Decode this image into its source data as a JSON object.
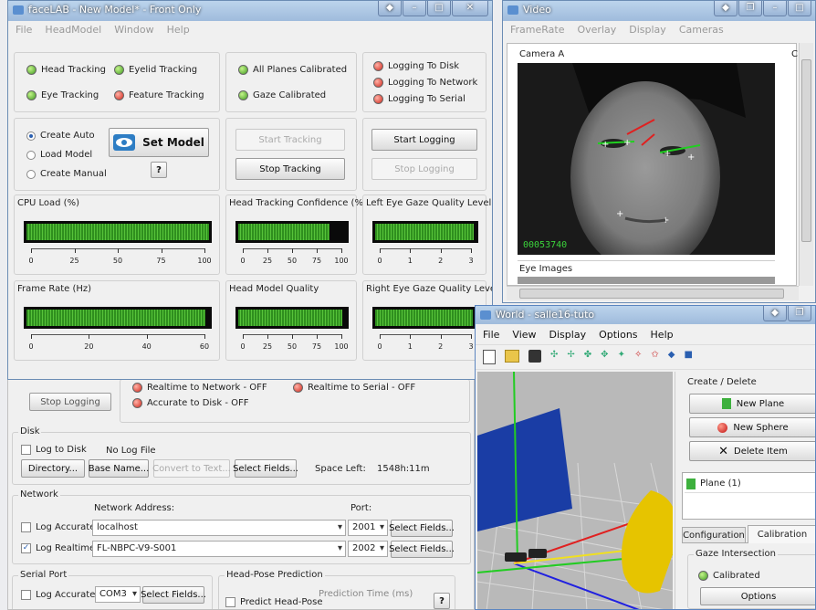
{
  "facelab": {
    "title": "faceLAB - New Model* - Front Only",
    "menu": [
      "File",
      "HeadModel",
      "Window",
      "Help"
    ],
    "status_left": [
      {
        "label": "Head Tracking",
        "color": "green"
      },
      {
        "label": "Eyelid Tracking",
        "color": "green"
      },
      {
        "label": "Eye Tracking",
        "color": "green"
      },
      {
        "label": "Feature Tracking",
        "color": "red"
      }
    ],
    "status_mid": [
      {
        "label": "All Planes Calibrated",
        "color": "green"
      },
      {
        "label": "Gaze Calibrated",
        "color": "green"
      }
    ],
    "status_right": [
      {
        "label": "Logging To Disk",
        "color": "red"
      },
      {
        "label": "Logging To Network",
        "color": "red"
      },
      {
        "label": "Logging To Serial",
        "color": "red"
      }
    ],
    "model_options": [
      {
        "label": "Create Auto",
        "selected": true
      },
      {
        "label": "Load Model",
        "selected": false
      },
      {
        "label": "Create Manual",
        "selected": false
      }
    ],
    "set_model": "Set Model",
    "help_glyph": "?",
    "start_tracking": "Start Tracking",
    "stop_tracking": "Stop Tracking",
    "start_logging": "Start Logging",
    "stop_logging": "Stop Logging",
    "meters": [
      {
        "title": "CPU Load (%)",
        "value": 1.0,
        "ticks": [
          "0",
          "25",
          "50",
          "75",
          "100"
        ]
      },
      {
        "title": "Head Tracking Confidence (%)",
        "value": 0.85,
        "ticks": [
          "0",
          "25",
          "50",
          "75",
          "100"
        ]
      },
      {
        "title": "Left Eye Gaze Quality Level",
        "value": 0.98,
        "ticks": [
          "0",
          "1",
          "2",
          "3"
        ]
      },
      {
        "title": "Frame Rate (Hz)",
        "value": 0.98,
        "ticks": [
          "0",
          "20",
          "40",
          "60"
        ]
      },
      {
        "title": "Head Model Quality",
        "value": 0.97,
        "ticks": [
          "0",
          "25",
          "50",
          "75",
          "100"
        ]
      },
      {
        "title": "Right Eye Gaze Quality Level",
        "value": 0.97,
        "ticks": [
          "0",
          "1",
          "2",
          "3"
        ]
      }
    ]
  },
  "logwin": {
    "stop_logging": "Stop Logging",
    "realtime_network": "Realtime to Network - OFF",
    "realtime_serial": "Realtime to Serial - OFF",
    "accurate_disk": "Accurate to Disk - OFF",
    "disk": {
      "title": "Disk",
      "log_to_disk": "Log to Disk",
      "no_log_file": "No Log File",
      "directory": "Directory...",
      "base_name": "Base Name...",
      "convert": "Convert to Text...",
      "select_fields": "Select Fields...",
      "space_left_label": "Space Left:",
      "space_left": "1548h:11m"
    },
    "network": {
      "title": "Network",
      "address_label": "Network Address:",
      "port_label": "Port:",
      "rows": [
        {
          "label": "Log Accurate",
          "checked": false,
          "address": "localhost",
          "port": "2001",
          "button": "Select Fields..."
        },
        {
          "label": "Log Realtime",
          "checked": true,
          "address": "FL-NBPC-V9-S001",
          "port": "2002",
          "button": "Select Fields..."
        }
      ]
    },
    "serial": {
      "title": "Serial Port",
      "log_accurate": "Log Accurate",
      "port": "COM3",
      "select_fields": "Select Fields..."
    },
    "headpose": {
      "title": "Head-Pose Prediction",
      "predict": "Predict Head-Pose",
      "prediction_time": "Prediction Time (ms)"
    }
  },
  "video": {
    "title": "Video",
    "menu": [
      "FrameRate",
      "Overlay",
      "Display",
      "Cameras"
    ],
    "camera": "Camera A",
    "frame_counter": "00053740",
    "eye_images": "Eye Images",
    "side_label": "C"
  },
  "world": {
    "title": "World - salle16-tuto",
    "menu": [
      "File",
      "View",
      "Display",
      "Options",
      "Help"
    ],
    "create_delete": "Create / Delete",
    "new_plane": "New Plane",
    "new_sphere": "New Sphere",
    "delete_item": "Delete Item",
    "list_item": "Plane (1)",
    "tabs": [
      "Configuration",
      "Calibration"
    ],
    "active_tab": "Calibration",
    "gaze_intersection": "Gaze Intersection",
    "calibrated": "Calibrated",
    "options": "Options"
  }
}
